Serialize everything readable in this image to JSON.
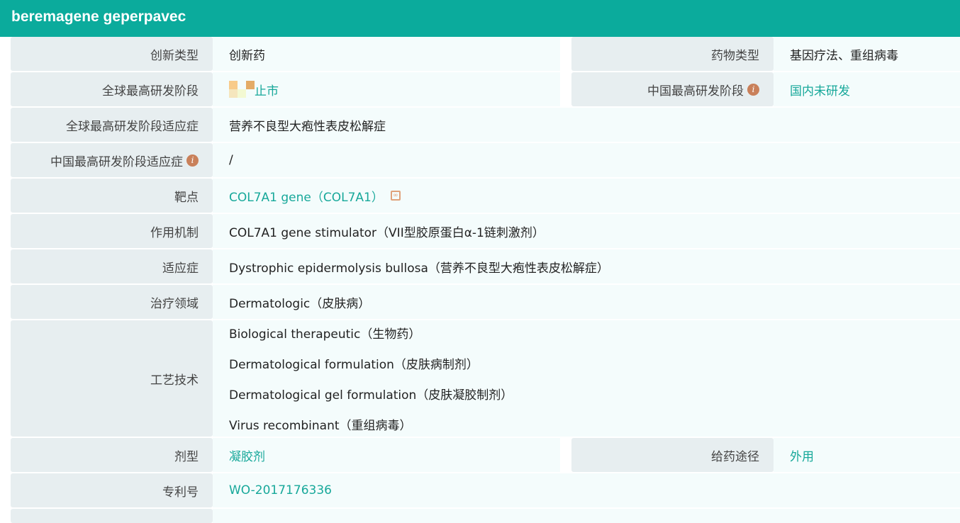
{
  "title": "beremagene geperpavec",
  "rows": {
    "innovation_type": {
      "label": "创新类型",
      "value": "创新药"
    },
    "drug_type": {
      "label": "药物类型",
      "value": "基因疗法、重组病毒"
    },
    "global_phase": {
      "label": "全球最高研发阶段",
      "value": "止市"
    },
    "china_phase": {
      "label": "中国最高研发阶段",
      "value": "国内未研发"
    },
    "global_indication": {
      "label": "全球最高研发阶段适应症",
      "value": "营养不良型大疱性表皮松解症"
    },
    "china_indication": {
      "label": "中国最高研发阶段适应症",
      "value": "/"
    },
    "target": {
      "label": "靶点",
      "value": "COL7A1 gene（COL7A1）"
    },
    "mechanism": {
      "label": "作用机制",
      "value": "COL7A1 gene stimulator（VII型胶原蛋白α-1链刺激剂）"
    },
    "indication": {
      "label": "适应症",
      "value": "Dystrophic epidermolysis bullosa（营养不良型大疱性表皮松解症）"
    },
    "area": {
      "label": "治疗领域",
      "value": "Dermatologic（皮肤病）"
    },
    "technology": {
      "label": "工艺技术",
      "values": [
        "Biological therapeutic（生物药）",
        "Dermatological formulation（皮肤病制剂）",
        "Dermatological gel formulation（皮肤凝胶制剂）",
        "Virus recombinant（重组病毒）"
      ]
    },
    "dosage_form": {
      "label": "剂型",
      "value": "凝胶剂"
    },
    "route": {
      "label": "给药途径",
      "value": "外用"
    },
    "patent": {
      "label": "专利号",
      "value": "WO-2017176336"
    }
  },
  "info_icon": "i"
}
